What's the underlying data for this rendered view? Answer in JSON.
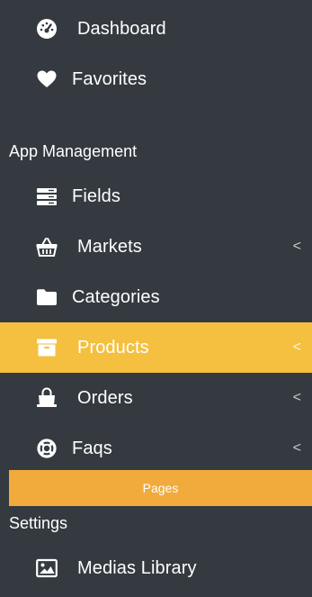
{
  "sidebar": {
    "items": [
      {
        "label": "Dashboard",
        "icon": "dashboard-gauge-icon",
        "has_chevron": false
      },
      {
        "label": "Favorites",
        "icon": "heart-icon",
        "has_chevron": false
      },
      {
        "label": "Fields",
        "icon": "server-list-icon",
        "has_chevron": false
      },
      {
        "label": "Markets",
        "icon": "basket-icon",
        "has_chevron": true
      },
      {
        "label": "Categories",
        "icon": "folder-icon",
        "has_chevron": false
      },
      {
        "label": "Products",
        "icon": "archive-box-icon",
        "has_chevron": true,
        "active": true
      },
      {
        "label": "Orders",
        "icon": "shopping-bag-icon",
        "has_chevron": true
      },
      {
        "label": "Faqs",
        "icon": "life-ring-icon",
        "has_chevron": true
      },
      {
        "label": "Medias Library",
        "icon": "image-icon",
        "has_chevron": false
      }
    ],
    "section_app_management": "App Management",
    "section_settings": "Settings",
    "pages_label": "Pages",
    "chevron_glyph": "<",
    "colors": {
      "background": "#343a40",
      "active": "#f5bf3f",
      "pages_bar": "#f0ab3c",
      "text": "#ffffff"
    }
  }
}
